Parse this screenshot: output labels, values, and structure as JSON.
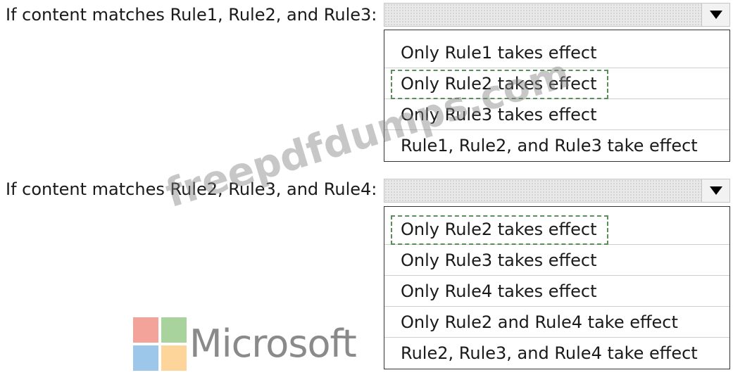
{
  "questions": [
    {
      "prompt": "If content matches Rule1, Rule2, and Rule3:",
      "selected_index": 1,
      "options": [
        "Only Rule1 takes effect",
        "Only Rule2 takes effect",
        "Only Rule3 takes effect",
        "Rule1, Rule2, and Rule3 take effect"
      ]
    },
    {
      "prompt": "If content matches Rule2, Rule3, and Rule4:",
      "selected_index": 0,
      "options": [
        "Only Rule2 takes effect",
        "Only Rule3 takes effect",
        "Only Rule4 takes effect",
        "Only Rule2 and Rule4 take effect",
        "Rule2, Rule3, and Rule4 take effect"
      ]
    }
  ],
  "logo": {
    "text": "Microsoft",
    "colors": [
      "#f4a39a",
      "#a8d39c",
      "#9cc6ea",
      "#fdd49a"
    ]
  },
  "watermark": "freepdfdumps.com",
  "icons": {
    "dropdown": "triangle-down-icon"
  }
}
